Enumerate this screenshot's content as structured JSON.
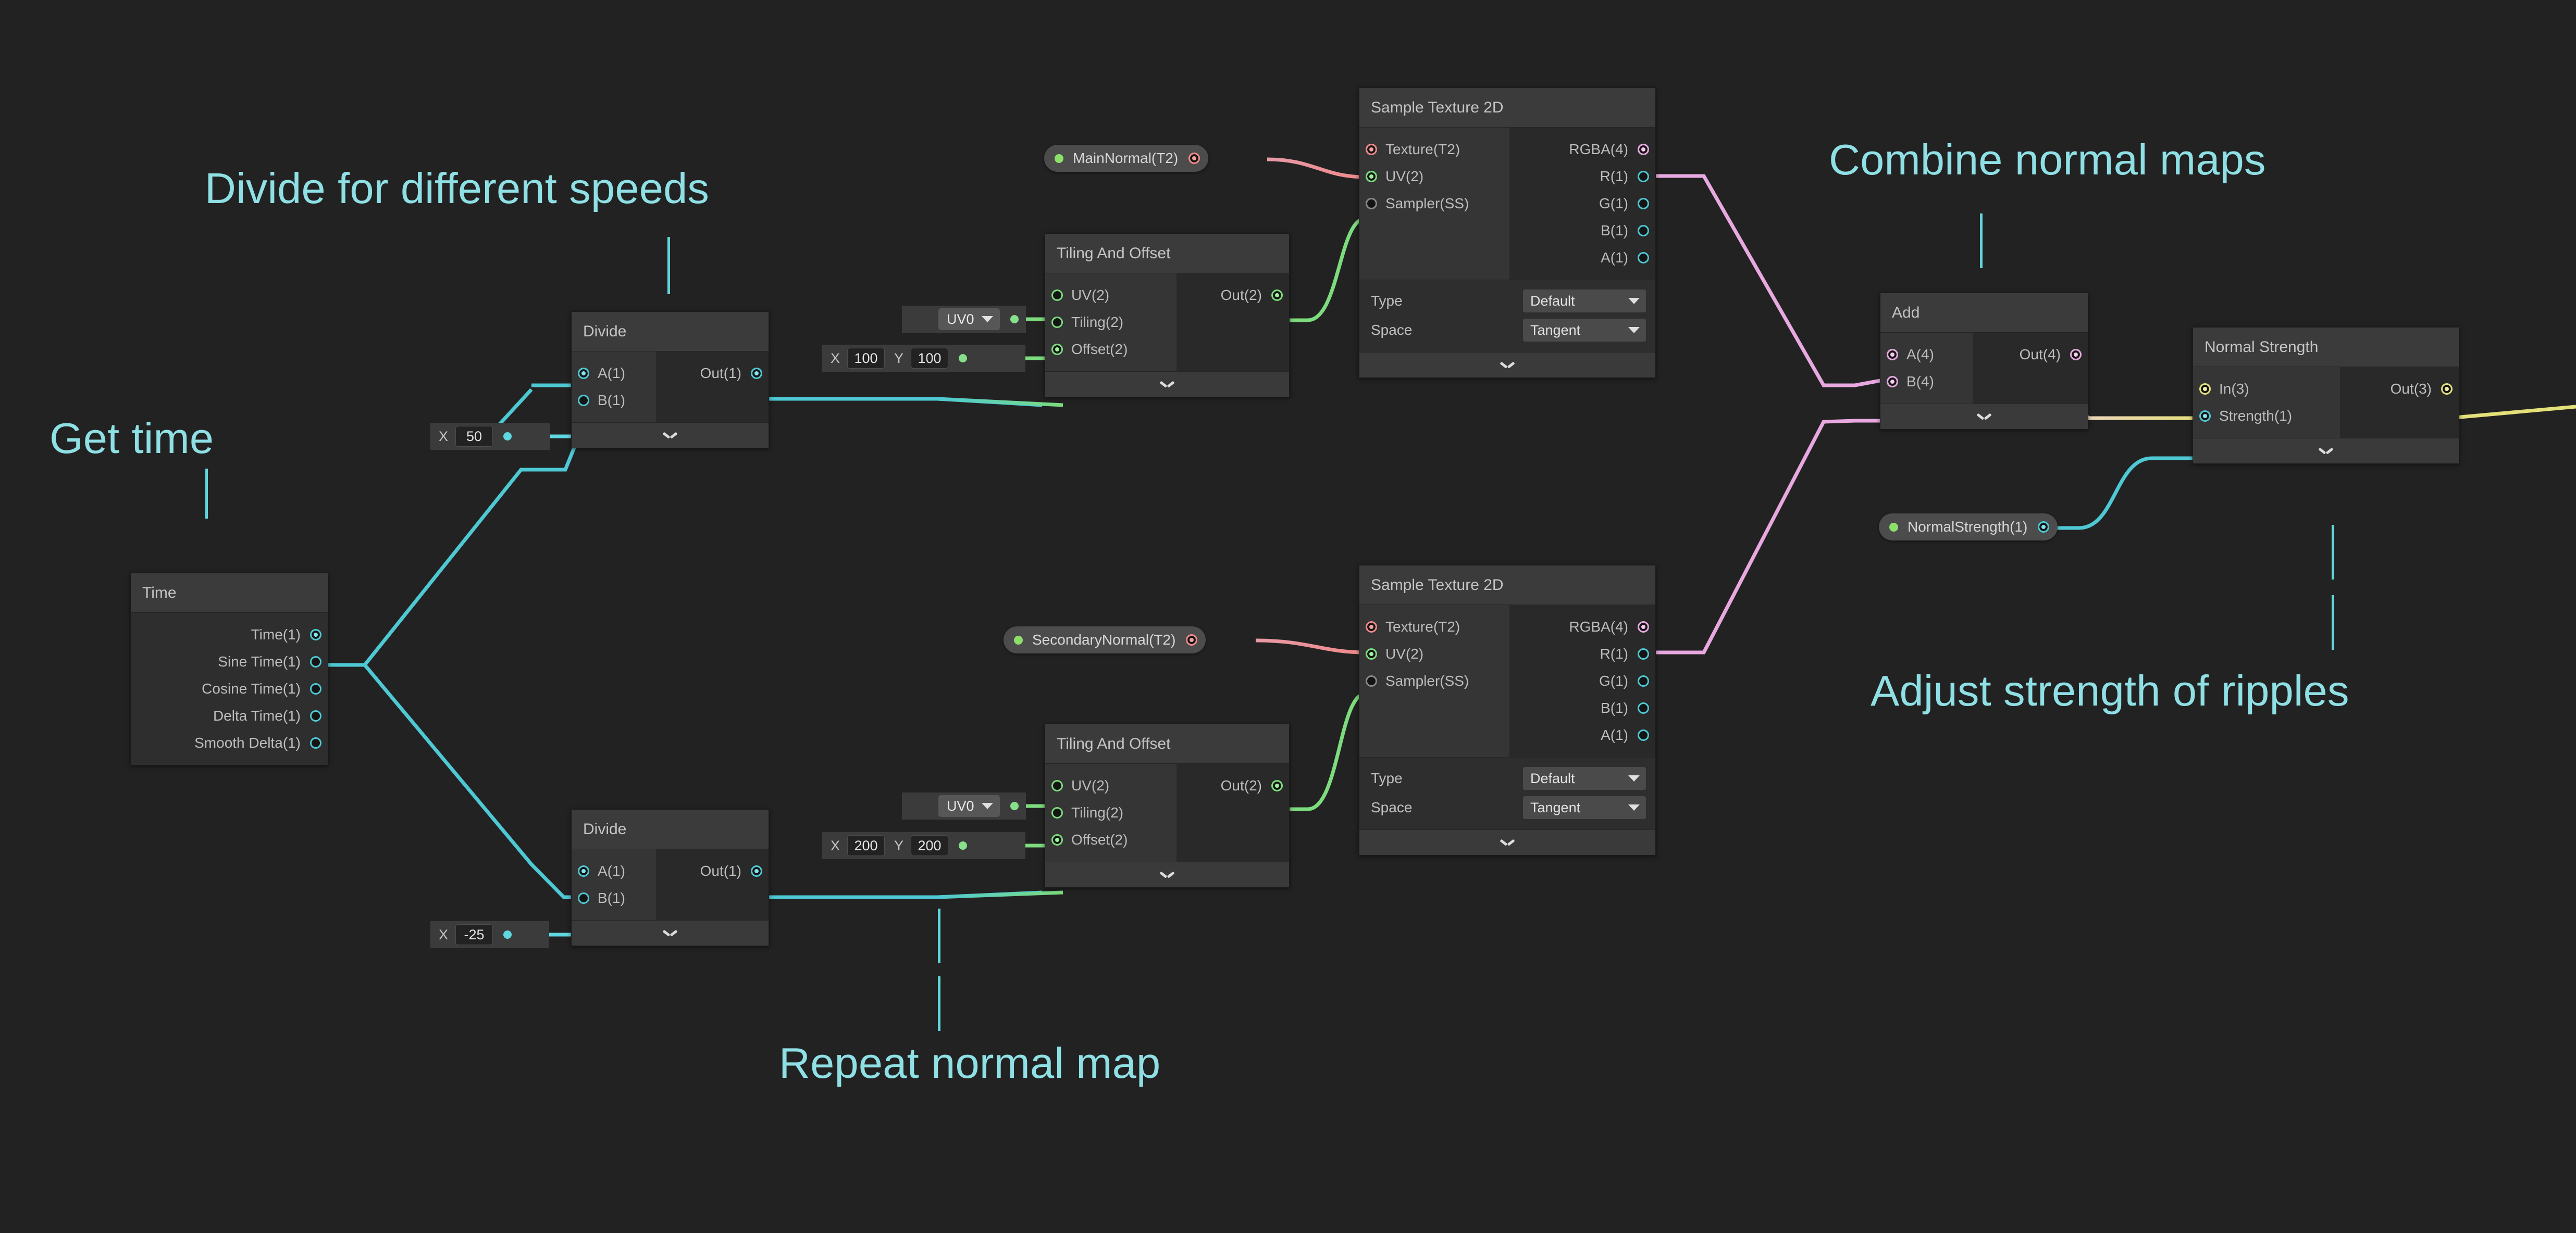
{
  "canvas": {
    "background": "#222222"
  },
  "palette": {
    "float": "#4ec9d4",
    "vector2": "#7ddc7d",
    "vector3": "#e4e07a",
    "vector4": "#e8a8e0",
    "texture2d": "#f08a8a",
    "samplerstate": "#8a8a8a",
    "annotation": "#8fe0e5"
  },
  "annotations": [
    {
      "id": "get-time",
      "text": "Get time"
    },
    {
      "id": "divide-speeds",
      "text": "Divide for different speeds"
    },
    {
      "id": "combine-normals",
      "text": "Combine normal maps"
    },
    {
      "id": "adjust-strength",
      "text": "Adjust strength of ripples"
    },
    {
      "id": "repeat-normal",
      "text": "Repeat normal map"
    }
  ],
  "nodes": {
    "time": {
      "title": "Time",
      "outputs": [
        {
          "label": "Time(1)",
          "type": "float",
          "connected": true
        },
        {
          "label": "Sine Time(1)",
          "type": "float",
          "connected": false
        },
        {
          "label": "Cosine Time(1)",
          "type": "float",
          "connected": false
        },
        {
          "label": "Delta Time(1)",
          "type": "float",
          "connected": false
        },
        {
          "label": "Smooth Delta(1)",
          "type": "float",
          "connected": false
        }
      ]
    },
    "divide_top": {
      "title": "Divide",
      "inputs": [
        {
          "label": "A(1)",
          "type": "float",
          "connected": true
        },
        {
          "label": "B(1)",
          "type": "float",
          "connected": false
        }
      ],
      "outputs": [
        {
          "label": "Out(1)",
          "type": "float",
          "connected": true
        }
      ]
    },
    "divide_bottom": {
      "title": "Divide",
      "inputs": [
        {
          "label": "A(1)",
          "type": "float",
          "connected": true
        },
        {
          "label": "B(1)",
          "type": "float",
          "connected": false
        }
      ],
      "outputs": [
        {
          "label": "Out(1)",
          "type": "float",
          "connected": true
        }
      ]
    },
    "tiling_top": {
      "title": "Tiling And Offset",
      "inputs": [
        {
          "label": "UV(2)",
          "type": "vector2",
          "connected": false
        },
        {
          "label": "Tiling(2)",
          "type": "vector2",
          "connected": false
        },
        {
          "label": "Offset(2)",
          "type": "vector2",
          "connected": true
        }
      ],
      "outputs": [
        {
          "label": "Out(2)",
          "type": "vector2",
          "connected": true
        }
      ]
    },
    "tiling_bottom": {
      "title": "Tiling And Offset",
      "inputs": [
        {
          "label": "UV(2)",
          "type": "vector2",
          "connected": false
        },
        {
          "label": "Tiling(2)",
          "type": "vector2",
          "connected": false
        },
        {
          "label": "Offset(2)",
          "type": "vector2",
          "connected": true
        }
      ],
      "outputs": [
        {
          "label": "Out(2)",
          "type": "vector2",
          "connected": true
        }
      ]
    },
    "sample_top": {
      "title": "Sample Texture 2D",
      "inputs": [
        {
          "label": "Texture(T2)",
          "type": "texture2d",
          "connected": true
        },
        {
          "label": "UV(2)",
          "type": "vector2",
          "connected": true
        },
        {
          "label": "Sampler(SS)",
          "type": "samplerstate",
          "connected": false
        }
      ],
      "outputs": [
        {
          "label": "RGBA(4)",
          "type": "vector4",
          "connected": true
        },
        {
          "label": "R(1)",
          "type": "float",
          "connected": false
        },
        {
          "label": "G(1)",
          "type": "float",
          "connected": false
        },
        {
          "label": "B(1)",
          "type": "float",
          "connected": false
        },
        {
          "label": "A(1)",
          "type": "float",
          "connected": false
        }
      ],
      "settings": [
        {
          "label": "Type",
          "value": "Default"
        },
        {
          "label": "Space",
          "value": "Tangent"
        }
      ]
    },
    "sample_bottom": {
      "title": "Sample Texture 2D",
      "inputs": [
        {
          "label": "Texture(T2)",
          "type": "texture2d",
          "connected": true
        },
        {
          "label": "UV(2)",
          "type": "vector2",
          "connected": true
        },
        {
          "label": "Sampler(SS)",
          "type": "samplerstate",
          "connected": false
        }
      ],
      "outputs": [
        {
          "label": "RGBA(4)",
          "type": "vector4",
          "connected": true
        },
        {
          "label": "R(1)",
          "type": "float",
          "connected": false
        },
        {
          "label": "G(1)",
          "type": "float",
          "connected": false
        },
        {
          "label": "B(1)",
          "type": "float",
          "connected": false
        },
        {
          "label": "A(1)",
          "type": "float",
          "connected": false
        }
      ],
      "settings": [
        {
          "label": "Type",
          "value": "Default"
        },
        {
          "label": "Space",
          "value": "Tangent"
        }
      ]
    },
    "add": {
      "title": "Add",
      "inputs": [
        {
          "label": "A(4)",
          "type": "vector4",
          "connected": true
        },
        {
          "label": "B(4)",
          "type": "vector4",
          "connected": true
        }
      ],
      "outputs": [
        {
          "label": "Out(4)",
          "type": "vector4",
          "connected": true
        }
      ]
    },
    "normal_strength": {
      "title": "Normal Strength",
      "inputs": [
        {
          "label": "In(3)",
          "type": "vector3",
          "connected": true
        },
        {
          "label": "Strength(1)",
          "type": "float",
          "connected": true
        }
      ],
      "outputs": [
        {
          "label": "Out(3)",
          "type": "vector3",
          "connected": true
        }
      ]
    }
  },
  "widgets": {
    "divide_top_b": {
      "axis": "X",
      "value": "50"
    },
    "divide_bottom_b": {
      "axis": "X",
      "value": "-25"
    },
    "tiling_top_uv": {
      "value": "UV0"
    },
    "tiling_top_tiling": {
      "axis_x": "X",
      "value_x": "100",
      "axis_y": "Y",
      "value_y": "100"
    },
    "tiling_bottom_uv": {
      "value": "UV0"
    },
    "tiling_bottom_tiling": {
      "axis_x": "X",
      "value_x": "200",
      "axis_y": "Y",
      "value_y": "200"
    }
  },
  "properties": {
    "main_normal": {
      "label": "MainNormal(T2)"
    },
    "secondary_normal": {
      "label": "SecondaryNormal(T2)"
    },
    "normal_strength": {
      "label": "NormalStrength(1)"
    }
  }
}
